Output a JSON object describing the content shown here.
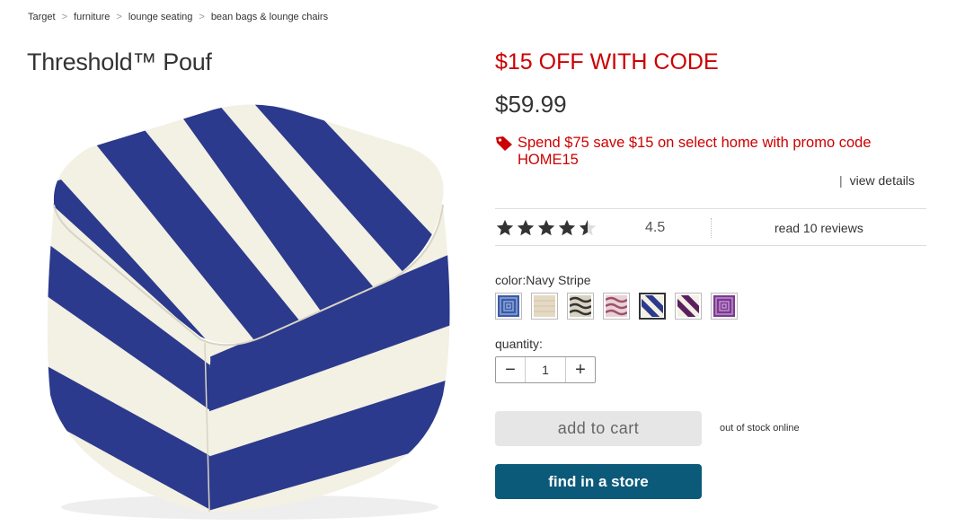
{
  "breadcrumb": {
    "items": [
      "Target",
      "furniture",
      "lounge seating",
      "bean bags & lounge chairs"
    ],
    "separator": ">"
  },
  "product": {
    "title": "Threshold™ Pouf",
    "image_icon": "striped-pouf-image",
    "colors": {
      "navy": "#2b3a8c",
      "cream": "#f3f0e4"
    }
  },
  "promo": {
    "headline": "$15 OFF WITH CODE",
    "offer_text": "Spend $75 save $15 on select home with promo code HOME15",
    "icon": "tag-icon",
    "color": "#cc0000",
    "view_details": "view details"
  },
  "price": "$59.99",
  "rating": {
    "value": "4.5",
    "stars": 4.5,
    "max_stars": 5,
    "reviews_link": "read 10 reviews"
  },
  "color_selector": {
    "label": "color:Navy Stripe",
    "selected_index": 4,
    "swatches": [
      {
        "name": "Navy Geometric",
        "icon": "blue-geometric-swatch"
      },
      {
        "name": "Cream",
        "icon": "cream-swatch"
      },
      {
        "name": "Black Wave",
        "icon": "black-wave-swatch"
      },
      {
        "name": "Pink Wave",
        "icon": "pink-wave-swatch"
      },
      {
        "name": "Navy Stripe",
        "icon": "navy-stripe-swatch"
      },
      {
        "name": "Purple Stripe",
        "icon": "purple-stripe-swatch"
      },
      {
        "name": "Purple Geometric",
        "icon": "purple-geometric-swatch"
      }
    ]
  },
  "quantity": {
    "label": "quantity:",
    "value": "1",
    "minus": "−",
    "plus": "+"
  },
  "actions": {
    "add_to_cart": "add to cart",
    "stock_status": "out of stock online",
    "find_in_store": "find in a store",
    "find_in_store_color": "#0c5a7a"
  }
}
